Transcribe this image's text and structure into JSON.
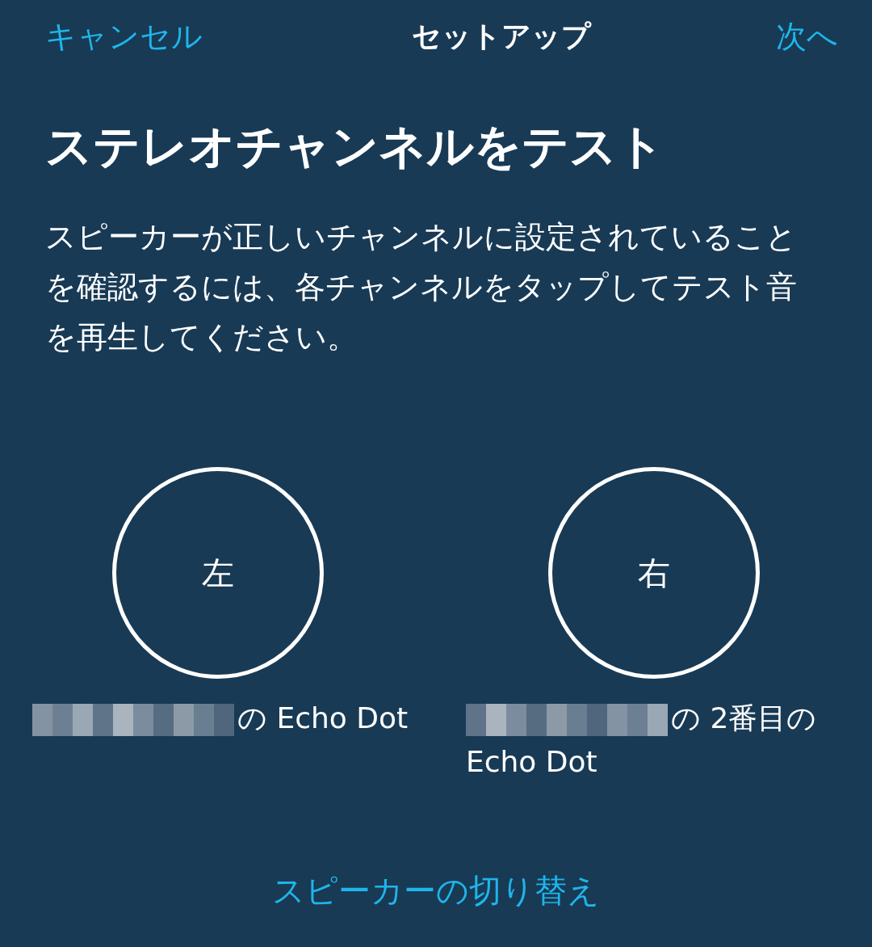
{
  "header": {
    "cancel": "キャンセル",
    "title": "セットアップ",
    "next": "次へ"
  },
  "heading": "ステレオチャンネルをテスト",
  "description": "スピーカーが正しいチャンネルに設定されていることを確認するには、各チャンネルをタップしてテスト音を再生してください。",
  "channels": [
    {
      "label": "左",
      "device_lines": [
        "の Echo Dot"
      ]
    },
    {
      "label": "右",
      "device_lines": [
        "の 2番目の",
        "Echo Dot"
      ]
    }
  ],
  "switch_link": "スピーカーの切り替え"
}
